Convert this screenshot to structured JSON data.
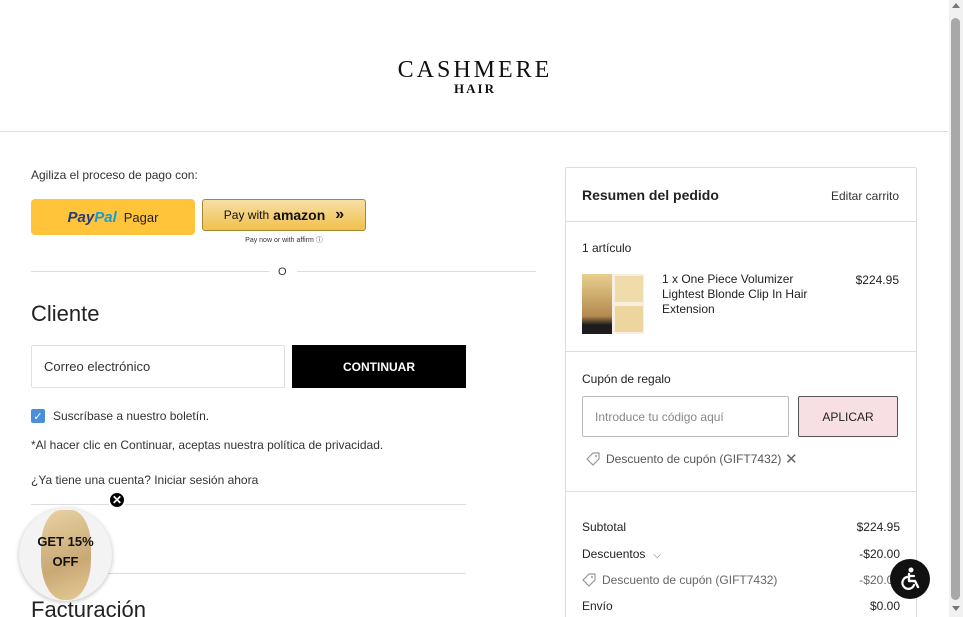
{
  "brand": {
    "name": "CASHMERE",
    "sub": "HAIR"
  },
  "express": {
    "label": "Agiliza el proceso de pago con:",
    "paypal": {
      "pay": "Pay",
      "pal": "Pal",
      "label": "Pagar"
    },
    "amazon": {
      "prefix": "Pay with",
      "brand": "amazon"
    },
    "affirm_note": "Pay now or with affirm ⓘ"
  },
  "divider_text": "O",
  "customer": {
    "heading": "Cliente",
    "email_placeholder": "Correo electrónico",
    "continue_label": "CONTINUAR",
    "newsletter_checked": true,
    "newsletter_label": "Suscríbase a nuestro boletín.",
    "privacy_note": "*Al hacer clic en Continuar, aceptas nuestra política de privacidad.",
    "account_question": "¿Ya tiene una cuenta?",
    "account_link": "Iniciar sesión ahora"
  },
  "billing": {
    "heading": "Facturación"
  },
  "promo": {
    "text": "GET 15%\nOFF",
    "close": "✕"
  },
  "summary": {
    "title": "Resumen del pedido",
    "edit_cart": "Editar carrito",
    "item_count": "1 artículo",
    "item": {
      "name": "1 x One Piece Volumizer Lightest Blonde Clip In Hair Extension",
      "price": "$224.95"
    },
    "coupon": {
      "label": "Cupón de regalo",
      "placeholder": "Introduce tu código aquí",
      "apply": "APLICAR",
      "applied": "Descuento de cupón (GIFT7432)"
    },
    "totals": {
      "subtotal_label": "Subtotal",
      "subtotal": "$224.95",
      "discounts_label": "Descuentos",
      "discounts": "-$20.00",
      "coupon_label": "Descuento de cupón (GIFT7432)",
      "coupon": "-$20.00",
      "shipping_label": "Envío",
      "shipping": "$0.00"
    }
  },
  "icons": [
    "tag-icon",
    "close-icon",
    "accessibility-icon",
    "chevron-down-icon",
    "checkmark-icon"
  ],
  "colors": {
    "paypal_yellow": "#ffc439",
    "continue_bg": "#000000",
    "apply_bg": "#f7dfe3",
    "checkbox": "#4a8fd8"
  }
}
